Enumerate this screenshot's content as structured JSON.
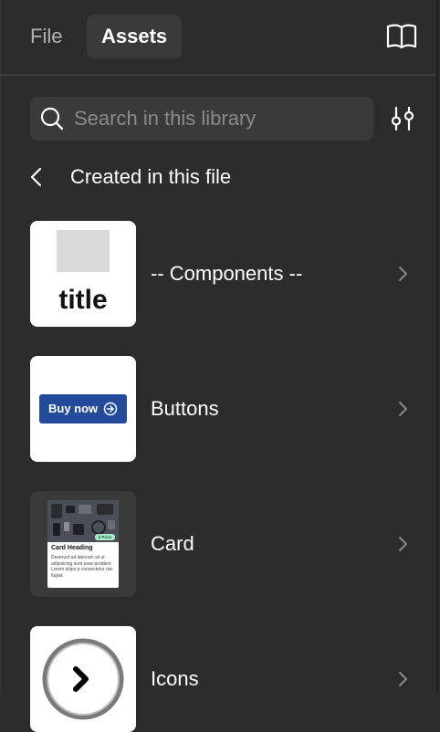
{
  "tabs": [
    {
      "label": "File",
      "active": false
    },
    {
      "label": "Assets",
      "active": true
    }
  ],
  "header": {
    "library_icon": "book-icon"
  },
  "search": {
    "placeholder": "Search in this library",
    "icon": "search-icon",
    "filter_icon": "filter-sliders-icon"
  },
  "section": {
    "back_icon": "chevron-left-icon",
    "title": "Created in this file"
  },
  "assets": [
    {
      "name": "-- Components --",
      "thumb_text": "title"
    },
    {
      "name": "Buttons",
      "thumb_button_label": "Buy now"
    },
    {
      "name": "Card",
      "thumb_heading": "Card Heading",
      "thumb_badge": "$ Price",
      "thumb_body": "Deserunt ad laborum sit ut adipisicing sunt esse proident Lorem aliqui p consectetur nisi fugiat."
    },
    {
      "name": "Icons"
    }
  ],
  "colors": {
    "panel_bg": "#2c2c2c",
    "field_bg": "#3a3a3a",
    "button_blue": "#234a9b",
    "text": "#ffffff",
    "muted_text": "#8a8a8a"
  }
}
